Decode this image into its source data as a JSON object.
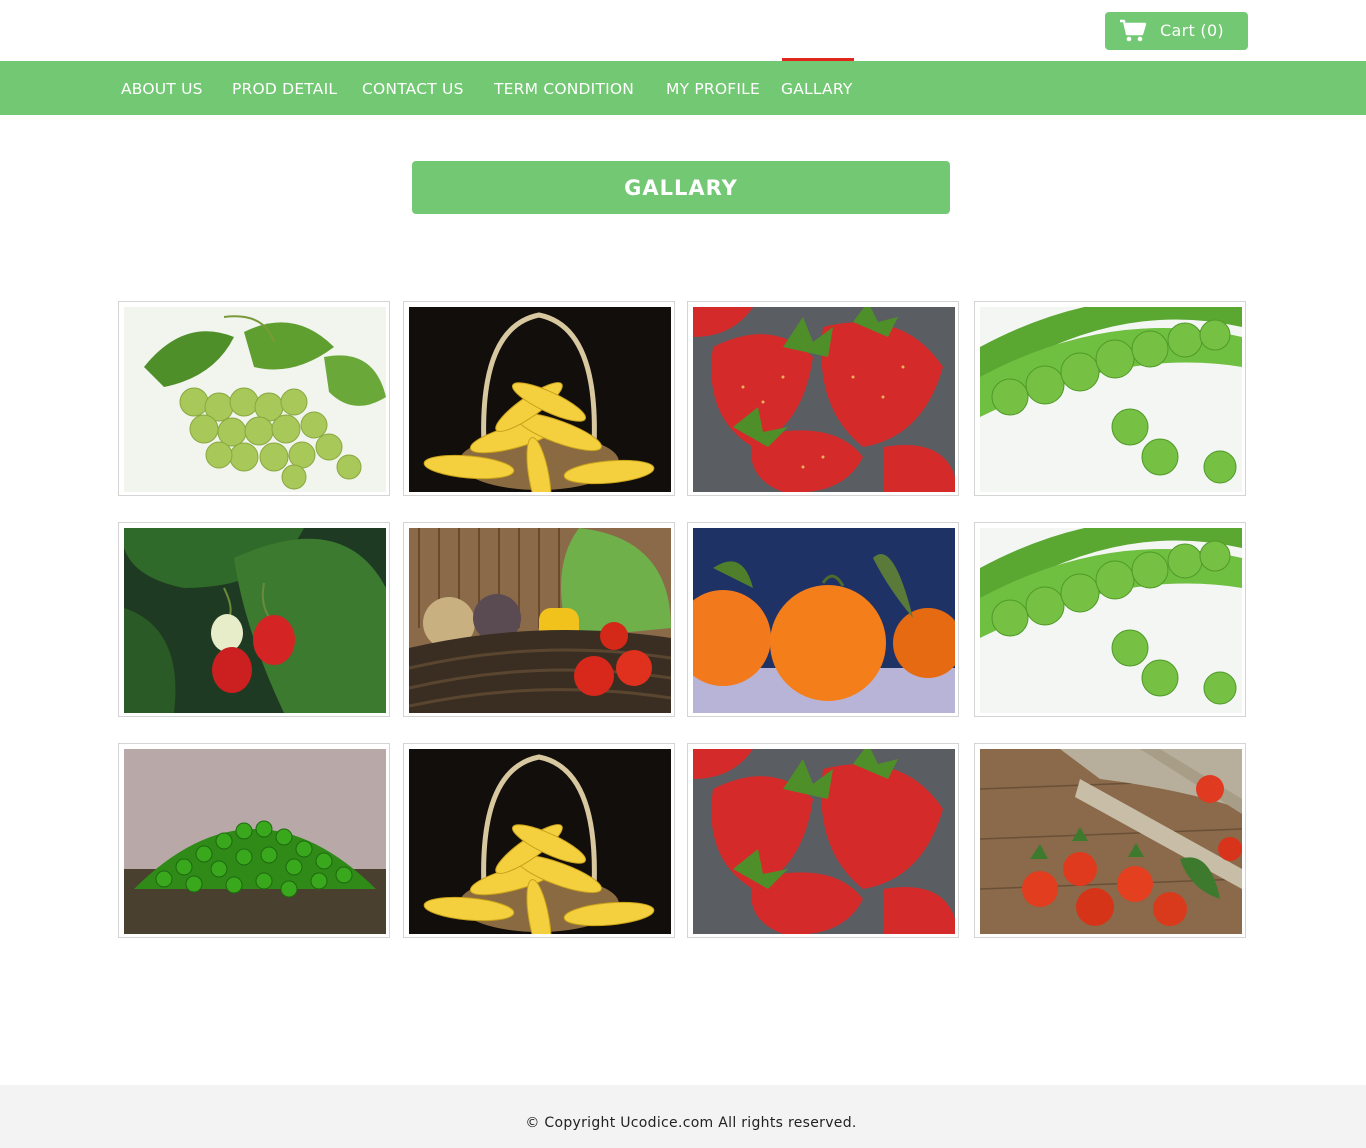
{
  "header": {
    "cart_label": "Cart (0)",
    "cart_icon": "shopping-cart-icon"
  },
  "nav": {
    "items": [
      {
        "label": "ABOUT US"
      },
      {
        "label": "PROD DETAIL"
      },
      {
        "label": "CONTACT US"
      },
      {
        "label": "TERM CONDITION"
      },
      {
        "label": "MY PROFILE"
      },
      {
        "label": "GALLARY"
      }
    ],
    "active": "GALLARY"
  },
  "page": {
    "title": "GALLARY"
  },
  "gallery": {
    "images": [
      {
        "subject": "green grapes"
      },
      {
        "subject": "corn in basket"
      },
      {
        "subject": "strawberries"
      },
      {
        "subject": "green peas pod"
      },
      {
        "subject": "strawberry plant"
      },
      {
        "subject": "vegetable basket"
      },
      {
        "subject": "tangerines"
      },
      {
        "subject": "green peas pod"
      },
      {
        "subject": "pile of green peas"
      },
      {
        "subject": "corn in basket"
      },
      {
        "subject": "strawberries"
      },
      {
        "subject": "tomatoes in crate"
      }
    ]
  },
  "footer": {
    "copyright": "© Copyright Ucodice.com All rights reserved."
  },
  "colors": {
    "brand_green": "#73c873",
    "active_underline": "#e0261d",
    "footer_bg": "#f3f3f3"
  }
}
